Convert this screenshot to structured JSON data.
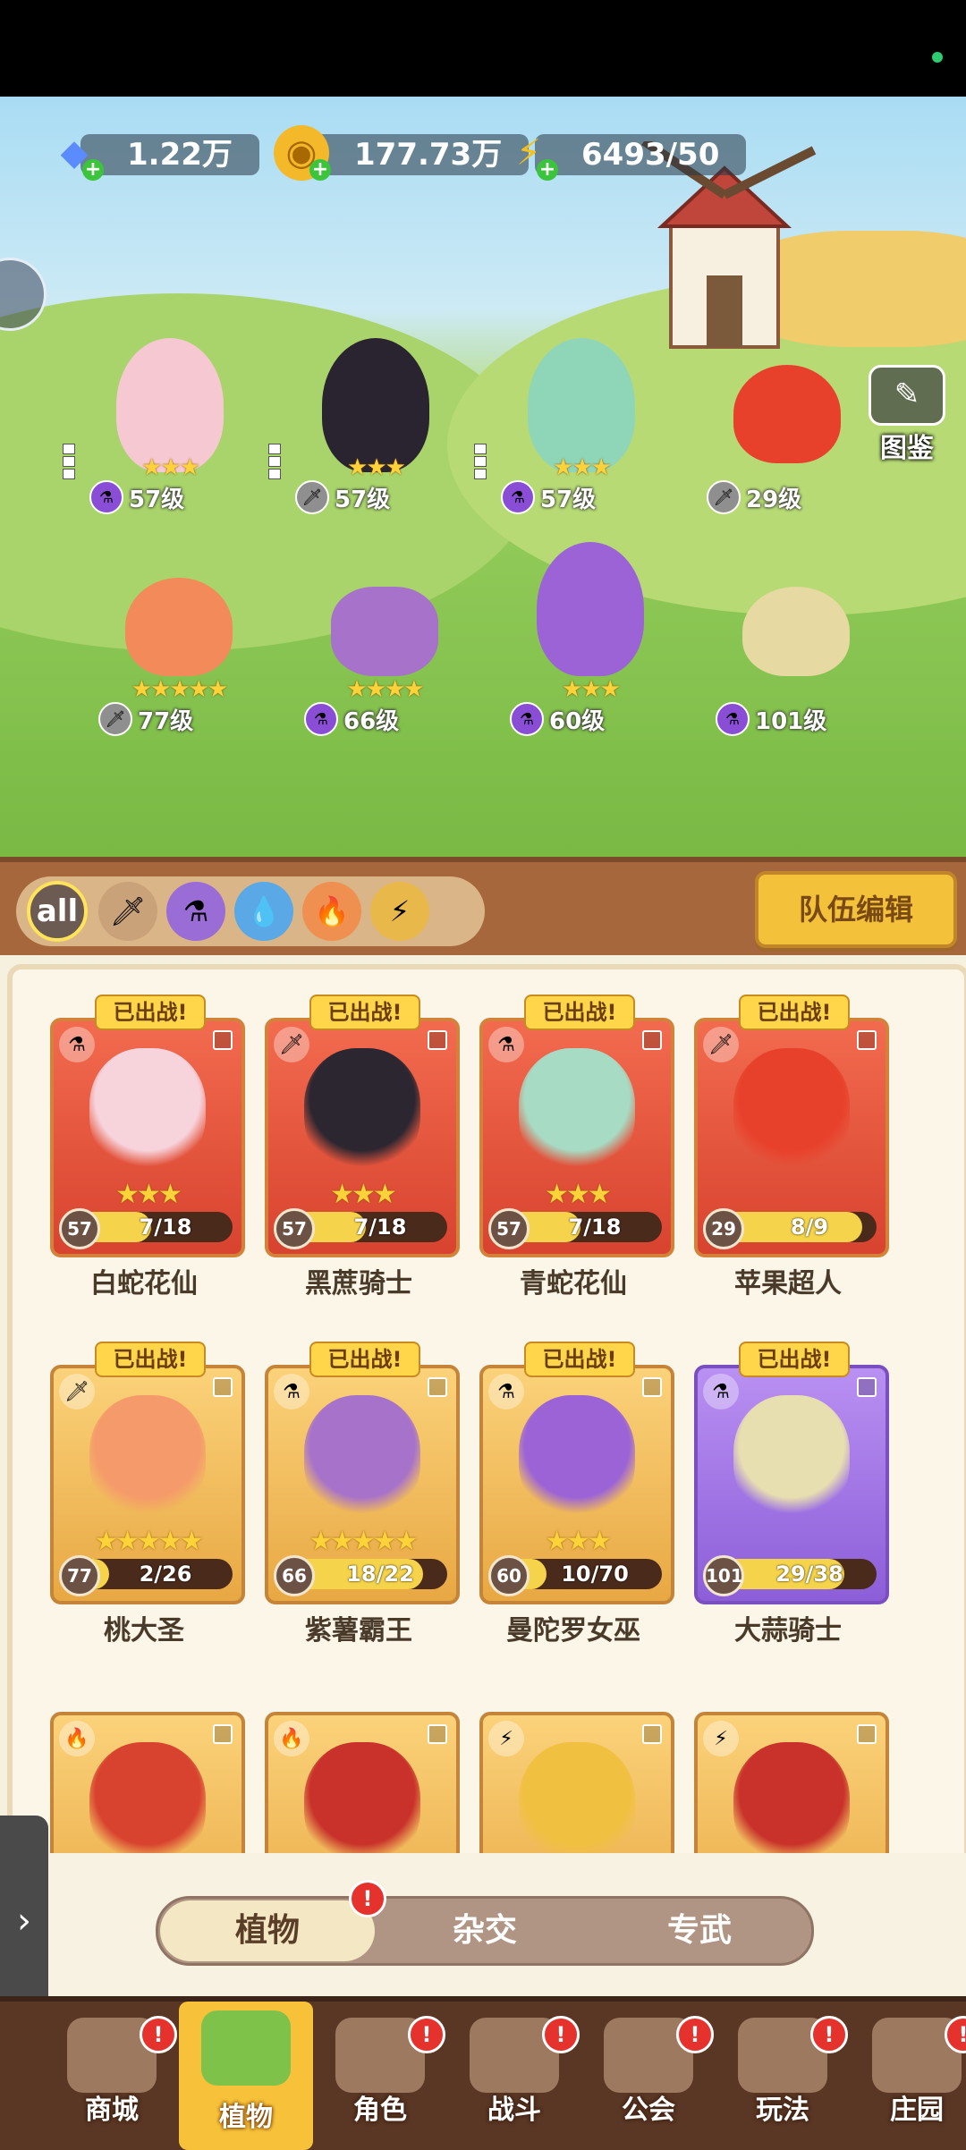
{
  "currencies": [
    {
      "name": "diamond",
      "icon": "diamond-icon",
      "value": "1.22万",
      "color": "#4a7af0"
    },
    {
      "name": "gold",
      "icon": "gold-coin-icon",
      "value": "177.73万",
      "color": "#f0b020"
    },
    {
      "name": "energy",
      "icon": "lightning-icon",
      "value": "6493/50",
      "color": "#f2c019"
    }
  ],
  "codex_label": "图鉴",
  "field_heroes": [
    {
      "name": "白蛇花仙",
      "stars": "★★★",
      "level": "57级",
      "element": "poison",
      "color": "#f6c9d2"
    },
    {
      "name": "黑蔗骑士",
      "stars": "★★★",
      "level": "57级",
      "element": "sword",
      "color": "#2a2430"
    },
    {
      "name": "青蛇花仙",
      "stars": "★★★",
      "level": "57级",
      "element": "poison",
      "color": "#8fd6b8"
    },
    {
      "name": "苹果超人",
      "stars": "",
      "level": "29级",
      "element": "sword",
      "color": "#e8412b"
    },
    {
      "name": "桃大圣",
      "stars": "★★★★★",
      "level": "77级",
      "element": "sword",
      "color": "#f28a5a"
    },
    {
      "name": "紫薯霸王",
      "stars": "★★★★",
      "level": "66级",
      "element": "poison",
      "color": "#a772c9"
    },
    {
      "name": "曼陀罗女巫",
      "stars": "★★★",
      "level": "60级",
      "element": "poison",
      "color": "#9b63d6"
    },
    {
      "name": "大蒜骑士",
      "stars": "",
      "level": "101级",
      "element": "poison",
      "color": "#e6d9a2"
    }
  ],
  "filter": {
    "all_label": "all",
    "elements": [
      "sword-icon",
      "poison-icon",
      "water-icon",
      "fire-icon",
      "lightning-icon"
    ],
    "team_edit_label": "队伍编辑"
  },
  "deployed_label": "已出战!",
  "cards": [
    {
      "name": "白蛇花仙",
      "level": "57",
      "progress": "7/18",
      "fill": 0.39,
      "stars": "★★★",
      "frame": "red",
      "element": "⚗",
      "art": "#f7d3dc",
      "deployed": true
    },
    {
      "name": "黑蔗骑士",
      "level": "57",
      "progress": "7/18",
      "fill": 0.39,
      "stars": "★★★",
      "frame": "red",
      "element": "🗡",
      "art": "#2c2630",
      "deployed": true
    },
    {
      "name": "青蛇花仙",
      "level": "57",
      "progress": "7/18",
      "fill": 0.39,
      "stars": "★★★",
      "frame": "red",
      "element": "⚗",
      "art": "#a7dbc4",
      "deployed": true
    },
    {
      "name": "苹果超人",
      "level": "29",
      "progress": "8/9",
      "fill": 0.89,
      "stars": "",
      "frame": "red",
      "element": "🗡",
      "art": "#e8412b",
      "deployed": true
    },
    {
      "name": "桃大圣",
      "level": "77",
      "progress": "2/26",
      "fill": 0.08,
      "stars": "★★★★★",
      "frame": "gold",
      "element": "🗡",
      "art": "#f59a6a",
      "deployed": true
    },
    {
      "name": "紫薯霸王",
      "level": "66",
      "progress": "18/22",
      "fill": 0.82,
      "stars": "★★★★★",
      "frame": "gold",
      "element": "⚗",
      "art": "#a772c9",
      "deployed": true
    },
    {
      "name": "曼陀罗女巫",
      "level": "60",
      "progress": "10/70",
      "fill": 0.14,
      "stars": "★★★",
      "frame": "purple-gold",
      "element": "⚗",
      "art": "#9b63d6",
      "deployed": true
    },
    {
      "name": "大蒜骑士",
      "level": "101",
      "progress": "29/38",
      "fill": 0.76,
      "stars": "",
      "frame": "purple",
      "element": "⚗",
      "art": "#e8dfb0",
      "deployed": true
    },
    {
      "name": "",
      "level": "",
      "progress": "",
      "fill": 0,
      "stars": "",
      "frame": "gold",
      "element": "🔥",
      "art": "#d8432f",
      "deployed": false
    },
    {
      "name": "",
      "level": "",
      "progress": "",
      "fill": 0,
      "stars": "",
      "frame": "gold",
      "element": "🔥",
      "art": "#c8322a",
      "deployed": false
    },
    {
      "name": "",
      "level": "",
      "progress": "",
      "fill": 0,
      "stars": "",
      "frame": "gold",
      "element": "⚡",
      "art": "#f0c040",
      "deployed": false
    },
    {
      "name": "",
      "level": "",
      "progress": "",
      "fill": 0,
      "stars": "",
      "frame": "gold",
      "element": "⚡",
      "art": "#c8322a",
      "deployed": false
    }
  ],
  "segments": {
    "items": [
      "植物",
      "杂交",
      "专武"
    ],
    "active": 0,
    "alert": "!"
  },
  "nav": {
    "items": [
      {
        "label": "商城",
        "alert": "!"
      },
      {
        "label": "植物",
        "alert": ""
      },
      {
        "label": "角色",
        "alert": "!"
      },
      {
        "label": "战斗",
        "alert": "!"
      },
      {
        "label": "公会",
        "alert": "!"
      },
      {
        "label": "玩法",
        "alert": "!"
      },
      {
        "label": "庄园",
        "alert": "!"
      }
    ],
    "active": 1
  }
}
